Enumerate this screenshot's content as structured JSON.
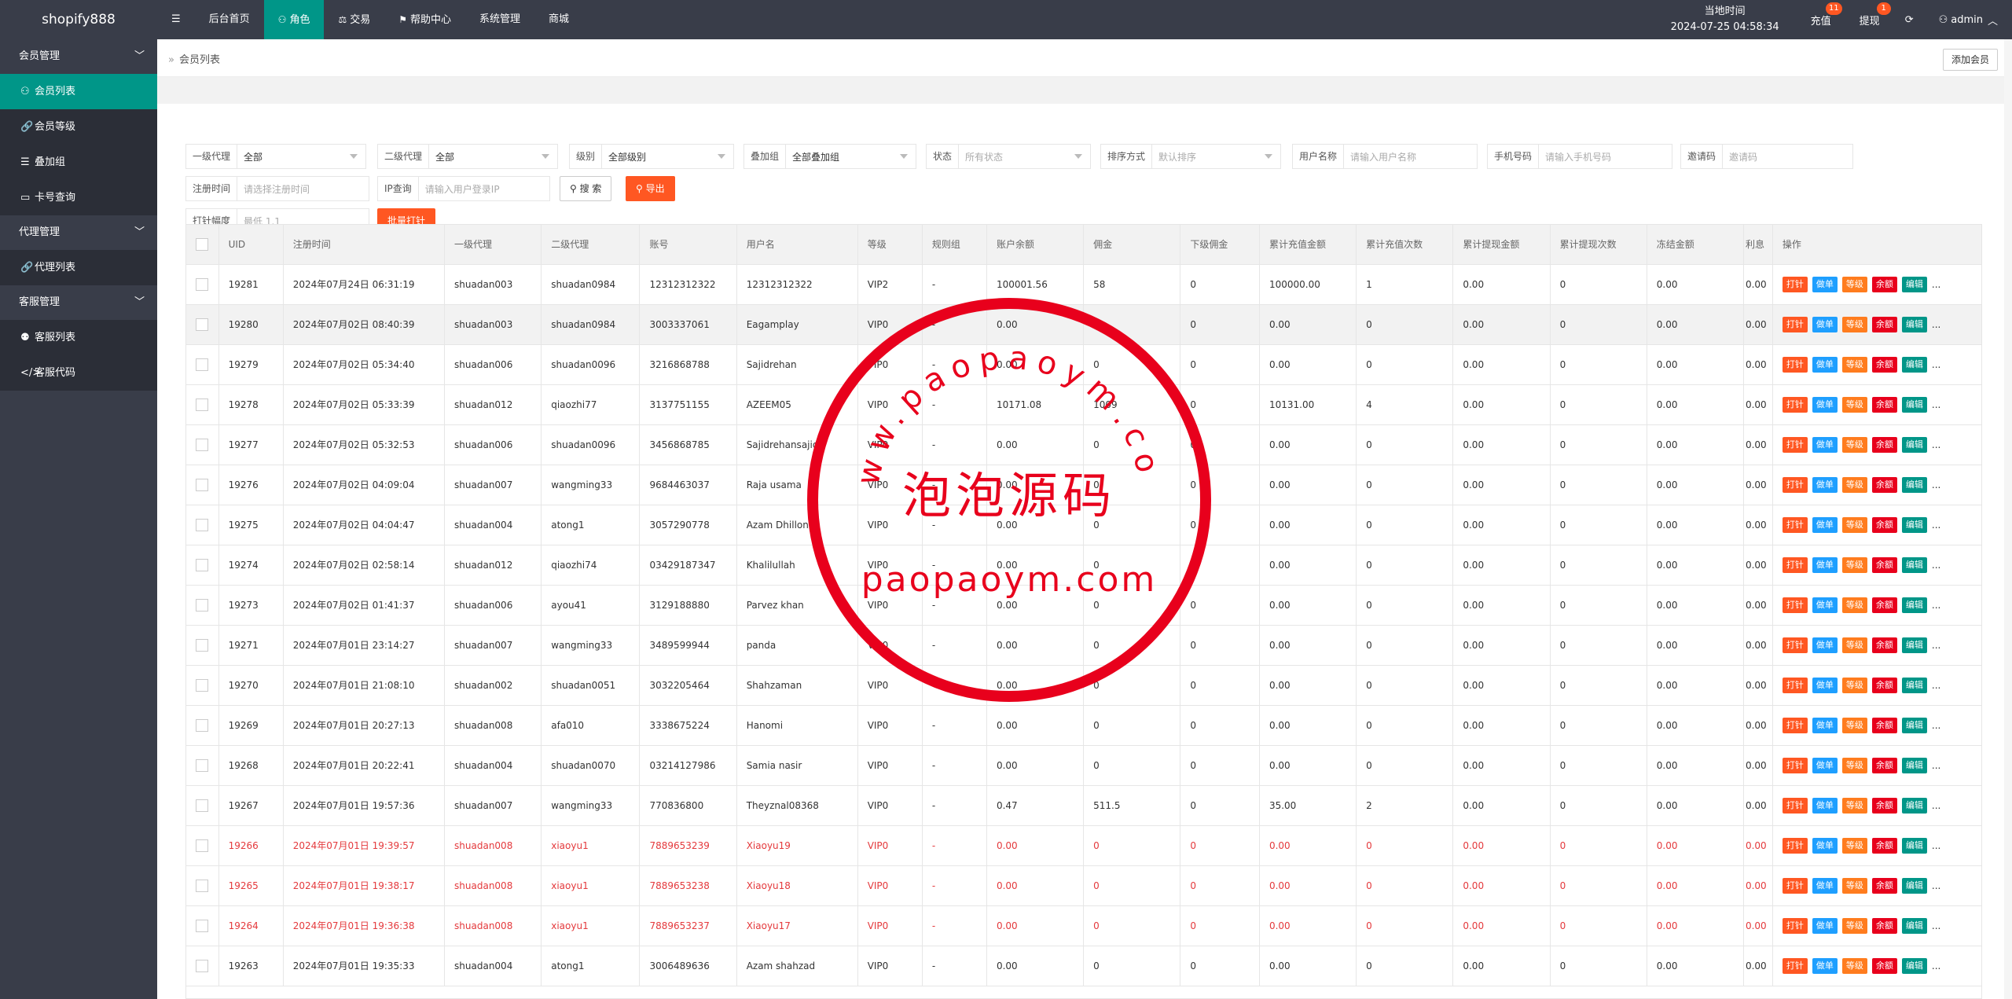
{
  "app": {
    "logo": "shopify888"
  },
  "nav": [
    {
      "label": "☰",
      "icon": "menu-icon"
    },
    {
      "label": "后台首页"
    },
    {
      "label": "角色",
      "icon": "user-icon",
      "active": true
    },
    {
      "label": "交易",
      "icon": "scale-icon"
    },
    {
      "label": "帮助中心",
      "icon": "flag-icon"
    },
    {
      "label": "系统管理"
    },
    {
      "label": "商城"
    }
  ],
  "topright": {
    "clock_label": "当地时间",
    "clock_value": "2024-07-25 04:58:34",
    "recharge": "充值",
    "recharge_badge": "11",
    "withdraw": "提现",
    "withdraw_badge": "1",
    "refresh_icon": "refresh-icon",
    "user": "admin"
  },
  "sidebar": {
    "groups": [
      {
        "label": "会员管理",
        "items": [
          {
            "label": "会员列表",
            "icon": "user-icon",
            "active": true
          },
          {
            "label": "会员等级",
            "icon": "link-icon"
          },
          {
            "label": "叠加组",
            "icon": "list-icon"
          },
          {
            "label": "卡号查询",
            "icon": "card-icon"
          }
        ]
      },
      {
        "label": "代理管理",
        "items": [
          {
            "label": "代理列表",
            "icon": "link-icon"
          }
        ]
      },
      {
        "label": "客服管理",
        "items": [
          {
            "label": "客服列表",
            "icon": "users-icon"
          },
          {
            "label": "客服代码",
            "icon": "code-icon"
          }
        ]
      }
    ]
  },
  "breadcrumb": {
    "sep": "»",
    "title": "会员列表",
    "add_button": "添加会员"
  },
  "filters": {
    "agent1": {
      "label": "一级代理",
      "value": "全部"
    },
    "agent2": {
      "label": "二级代理",
      "value": "全部"
    },
    "level": {
      "label": "级别",
      "value": "全部级别"
    },
    "stack": {
      "label": "叠加组",
      "value": "全部叠加组"
    },
    "status": {
      "label": "状态",
      "placeholder": "所有状态"
    },
    "sort": {
      "label": "排序方式",
      "placeholder": "默认排序"
    },
    "username": {
      "label": "用户名称",
      "placeholder": "请输入用户名称"
    },
    "phone": {
      "label": "手机号码",
      "placeholder": "请输入手机号码"
    },
    "invite": {
      "label": "邀请码",
      "placeholder": "邀请码"
    },
    "regtime": {
      "label": "注册时间",
      "placeholder": "请选择注册时间"
    },
    "ip": {
      "label": "IP查询",
      "placeholder": "请输入用户登录IP"
    },
    "search_button": "搜 索",
    "export_button": "导出",
    "amp": {
      "label": "打针幅度",
      "placeholder": "最低 1.1"
    },
    "batch_button": "批量打针"
  },
  "table": {
    "columns": [
      "",
      "UID",
      "注册时间",
      "一级代理",
      "二级代理",
      "账号",
      "用户名",
      "等级",
      "规则组",
      "账户余额",
      "佣金",
      "下级佣金",
      "累计充值金额",
      "累计充值次数",
      "累计提现金额",
      "累计提现次数",
      "冻结金额",
      "利息",
      "操作"
    ],
    "actions": [
      "打针",
      "做单",
      "等级",
      "余额",
      "编辑",
      "..."
    ],
    "rows": [
      {
        "uid": "19281",
        "time": "2024年07月24日 06:31:19",
        "a1": "shuadan003",
        "a2": "shuadan0984",
        "acct": "12312312322",
        "name": "12312312322",
        "level": "VIP2",
        "rule": "-",
        "bal": "100001.56",
        "comm": "58",
        "sub": "0",
        "rc": "100000.00",
        "rcn": "1",
        "wd": "0.00",
        "wdn": "0",
        "frz": "0.00",
        "int": "0.00"
      },
      {
        "uid": "19280",
        "time": "2024年07月02日 08:40:39",
        "a1": "shuadan003",
        "a2": "shuadan0984",
        "acct": "3003337061",
        "name": "Eagamplay",
        "level": "VIP0",
        "rule": "-",
        "bal": "0.00",
        "comm": "0",
        "sub": "0",
        "rc": "0.00",
        "rcn": "0",
        "wd": "0.00",
        "wdn": "0",
        "frz": "0.00",
        "int": "0.00"
      },
      {
        "uid": "19279",
        "time": "2024年07月02日 05:34:40",
        "a1": "shuadan006",
        "a2": "shuadan0096",
        "acct": "3216868788",
        "name": "Sajidrehan",
        "level": "VIP0",
        "rule": "-",
        "bal": "0.00",
        "comm": "0",
        "sub": "0",
        "rc": "0.00",
        "rcn": "0",
        "wd": "0.00",
        "wdn": "0",
        "frz": "0.00",
        "int": "0.00"
      },
      {
        "uid": "19278",
        "time": "2024年07月02日 05:33:39",
        "a1": "shuadan012",
        "a2": "qiaozhi77",
        "acct": "3137751155",
        "name": "AZEEM05",
        "level": "VIP0",
        "rule": "-",
        "bal": "10171.08",
        "comm": "1009",
        "sub": "0",
        "rc": "10131.00",
        "rcn": "4",
        "wd": "0.00",
        "wdn": "0",
        "frz": "0.00",
        "int": "0.00"
      },
      {
        "uid": "19277",
        "time": "2024年07月02日 05:32:53",
        "a1": "shuadan006",
        "a2": "shuadan0096",
        "acct": "3456868785",
        "name": "Sajidrehansajid",
        "level": "VIP0",
        "rule": "-",
        "bal": "0.00",
        "comm": "0",
        "sub": "0",
        "rc": "0.00",
        "rcn": "0",
        "wd": "0.00",
        "wdn": "0",
        "frz": "0.00",
        "int": "0.00"
      },
      {
        "uid": "19276",
        "time": "2024年07月02日 04:09:04",
        "a1": "shuadan007",
        "a2": "wangming33",
        "acct": "9684463037",
        "name": "Raja usama",
        "level": "VIP0",
        "rule": "-",
        "bal": "0.00",
        "comm": "0",
        "sub": "0",
        "rc": "0.00",
        "rcn": "0",
        "wd": "0.00",
        "wdn": "0",
        "frz": "0.00",
        "int": "0.00"
      },
      {
        "uid": "19275",
        "time": "2024年07月02日 04:04:47",
        "a1": "shuadan004",
        "a2": "atong1",
        "acct": "3057290778",
        "name": "Azam Dhillon",
        "level": "VIP0",
        "rule": "-",
        "bal": "0.00",
        "comm": "0",
        "sub": "0",
        "rc": "0.00",
        "rcn": "0",
        "wd": "0.00",
        "wdn": "0",
        "frz": "0.00",
        "int": "0.00"
      },
      {
        "uid": "19274",
        "time": "2024年07月02日 02:58:14",
        "a1": "shuadan012",
        "a2": "qiaozhi74",
        "acct": "03429187347",
        "name": "Khalilullah",
        "level": "VIP0",
        "rule": "-",
        "bal": "0.00",
        "comm": "0",
        "sub": "0",
        "rc": "0.00",
        "rcn": "0",
        "wd": "0.00",
        "wdn": "0",
        "frz": "0.00",
        "int": "0.00"
      },
      {
        "uid": "19273",
        "time": "2024年07月02日 01:41:37",
        "a1": "shuadan006",
        "a2": "ayou41",
        "acct": "3129188880",
        "name": "Parvez khan",
        "level": "VIP0",
        "rule": "-",
        "bal": "0.00",
        "comm": "0",
        "sub": "0",
        "rc": "0.00",
        "rcn": "0",
        "wd": "0.00",
        "wdn": "0",
        "frz": "0.00",
        "int": "0.00"
      },
      {
        "uid": "19271",
        "time": "2024年07月01日 23:14:27",
        "a1": "shuadan007",
        "a2": "wangming33",
        "acct": "3489599944",
        "name": "panda",
        "level": "VIP0",
        "rule": "-",
        "bal": "0.00",
        "comm": "0",
        "sub": "0",
        "rc": "0.00",
        "rcn": "0",
        "wd": "0.00",
        "wdn": "0",
        "frz": "0.00",
        "int": "0.00"
      },
      {
        "uid": "19270",
        "time": "2024年07月01日 21:08:10",
        "a1": "shuadan002",
        "a2": "shuadan0051",
        "acct": "3032205464",
        "name": "Shahzaman",
        "level": "VIP0",
        "rule": "-",
        "bal": "0.00",
        "comm": "0",
        "sub": "0",
        "rc": "0.00",
        "rcn": "0",
        "wd": "0.00",
        "wdn": "0",
        "frz": "0.00",
        "int": "0.00"
      },
      {
        "uid": "19269",
        "time": "2024年07月01日 20:27:13",
        "a1": "shuadan008",
        "a2": "afa010",
        "acct": "3338675224",
        "name": "Hanomi",
        "level": "VIP0",
        "rule": "-",
        "bal": "0.00",
        "comm": "0",
        "sub": "0",
        "rc": "0.00",
        "rcn": "0",
        "wd": "0.00",
        "wdn": "0",
        "frz": "0.00",
        "int": "0.00"
      },
      {
        "uid": "19268",
        "time": "2024年07月01日 20:22:41",
        "a1": "shuadan004",
        "a2": "shuadan0070",
        "acct": "03214127986",
        "name": "Samia nasir",
        "level": "VIP0",
        "rule": "-",
        "bal": "0.00",
        "comm": "0",
        "sub": "0",
        "rc": "0.00",
        "rcn": "0",
        "wd": "0.00",
        "wdn": "0",
        "frz": "0.00",
        "int": "0.00"
      },
      {
        "uid": "19267",
        "time": "2024年07月01日 19:57:36",
        "a1": "shuadan007",
        "a2": "wangming33",
        "acct": "770836800",
        "name": "Theyznal08368",
        "level": "VIP0",
        "rule": "-",
        "bal": "0.47",
        "comm": "511.5",
        "sub": "0",
        "rc": "35.00",
        "rcn": "2",
        "wd": "0.00",
        "wdn": "0",
        "frz": "0.00",
        "int": "0.00"
      },
      {
        "uid": "19266",
        "time": "2024年07月01日 19:39:57",
        "a1": "shuadan008",
        "a2": "xiaoyu1",
        "acct": "7889653239",
        "name": "Xiaoyu19",
        "level": "VIP0",
        "rule": "-",
        "bal": "0.00",
        "comm": "0",
        "sub": "0",
        "rc": "0.00",
        "rcn": "0",
        "wd": "0.00",
        "wdn": "0",
        "frz": "0.00",
        "int": "0.00",
        "red": true
      },
      {
        "uid": "19265",
        "time": "2024年07月01日 19:38:17",
        "a1": "shuadan008",
        "a2": "xiaoyu1",
        "acct": "7889653238",
        "name": "Xiaoyu18",
        "level": "VIP0",
        "rule": "-",
        "bal": "0.00",
        "comm": "0",
        "sub": "0",
        "rc": "0.00",
        "rcn": "0",
        "wd": "0.00",
        "wdn": "0",
        "frz": "0.00",
        "int": "0.00",
        "red": true
      },
      {
        "uid": "19264",
        "time": "2024年07月01日 19:36:38",
        "a1": "shuadan008",
        "a2": "xiaoyu1",
        "acct": "7889653237",
        "name": "Xiaoyu17",
        "level": "VIP0",
        "rule": "-",
        "bal": "0.00",
        "comm": "0",
        "sub": "0",
        "rc": "0.00",
        "rcn": "0",
        "wd": "0.00",
        "wdn": "0",
        "frz": "0.00",
        "int": "0.00",
        "red": true
      },
      {
        "uid": "19263",
        "time": "2024年07月01日 19:35:33",
        "a1": "shuadan004",
        "a2": "atong1",
        "acct": "3006489636",
        "name": "Azam shahzad",
        "level": "VIP0",
        "rule": "-",
        "bal": "0.00",
        "comm": "0",
        "sub": "0",
        "rc": "0.00",
        "rcn": "0",
        "wd": "0.00",
        "wdn": "0",
        "frz": "0.00",
        "int": "0.00"
      }
    ]
  },
  "watermark": {
    "top_text": "www.paopaoym.com",
    "center_text": "泡泡源码",
    "bottom_text": "paopaoym.com",
    "color": "#e8001c"
  },
  "colors": {
    "topbar": "#393d49",
    "accent": "#009688",
    "orange": "#ff5722",
    "blue": "#1e9fff",
    "red": "#e8001c",
    "rowRed": "#e4393c"
  }
}
